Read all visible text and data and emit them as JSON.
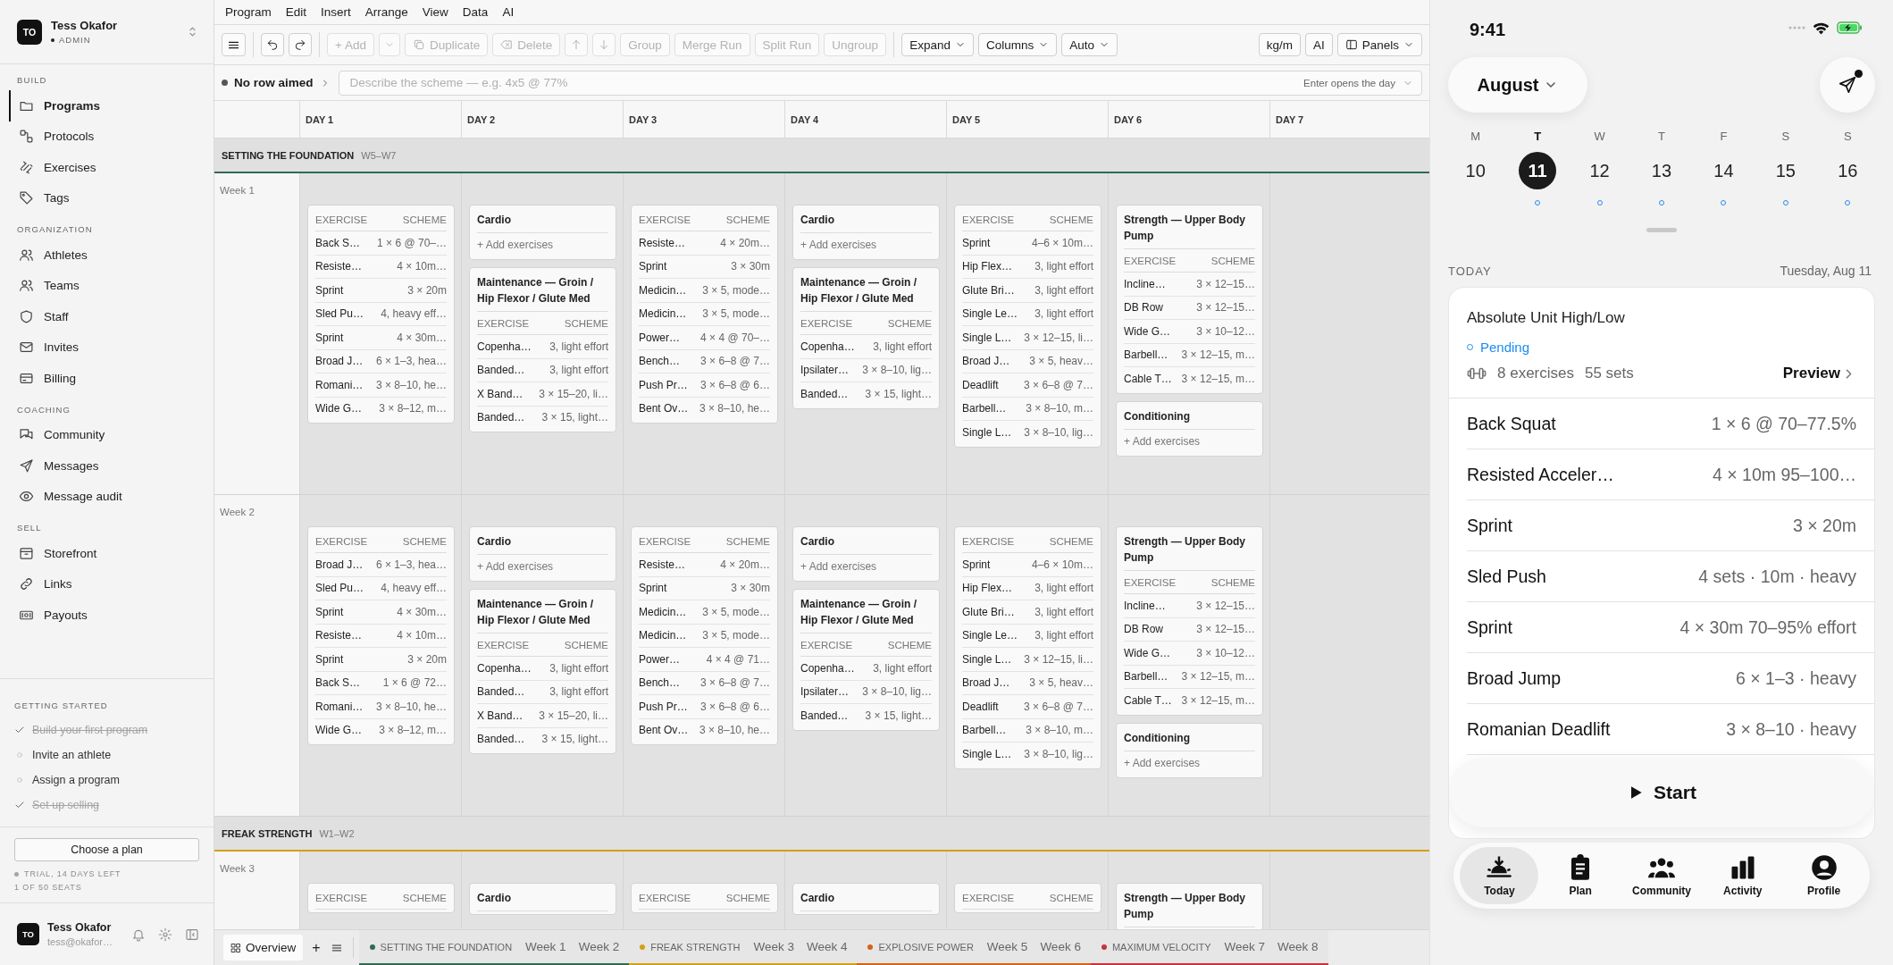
{
  "sidebar": {
    "user": {
      "initials": "TO",
      "name": "Tess Okafor",
      "role": "ADMIN"
    },
    "groups": [
      {
        "label": "BUILD",
        "items": [
          {
            "label": "Programs",
            "selected": true
          },
          {
            "label": "Protocols",
            "selected": false
          },
          {
            "label": "Exercises",
            "selected": false
          },
          {
            "label": "Tags",
            "selected": false
          }
        ]
      },
      {
        "label": "ORGANIZATION",
        "items": [
          {
            "label": "Athletes",
            "selected": false
          },
          {
            "label": "Teams",
            "selected": false
          },
          {
            "label": "Staff",
            "selected": false
          },
          {
            "label": "Invites",
            "selected": false
          },
          {
            "label": "Billing",
            "selected": false
          }
        ]
      },
      {
        "label": "COACHING",
        "items": [
          {
            "label": "Community",
            "selected": false
          },
          {
            "label": "Messages",
            "selected": false
          },
          {
            "label": "Message audit",
            "selected": false
          }
        ]
      },
      {
        "label": "SELL",
        "items": [
          {
            "label": "Storefront",
            "selected": false
          },
          {
            "label": "Links",
            "selected": false
          },
          {
            "label": "Payouts",
            "selected": false
          }
        ]
      }
    ],
    "getting_started": {
      "title": "GETTING STARTED",
      "items": [
        {
          "label": "Build your first program",
          "done": true
        },
        {
          "label": "Invite an athlete",
          "done": false
        },
        {
          "label": "Assign a program",
          "done": false
        },
        {
          "label": "Set up selling",
          "done": true
        }
      ]
    },
    "plan_button": "Choose a plan",
    "trial": "TRIAL, 14 DAYS LEFT",
    "seats": "1 OF 50 SEATS",
    "footer": {
      "initials": "TO",
      "name": "Tess Okafor",
      "email": "tess@okafor…"
    }
  },
  "menu": [
    "Program",
    "Edit",
    "Insert",
    "Arrange",
    "View",
    "Data",
    "AI"
  ],
  "toolbar": {
    "actions": [
      {
        "label": "+ Add",
        "disabled": true
      },
      {
        "label": "Duplicate",
        "disabled": true
      },
      {
        "label": "Delete",
        "disabled": true
      },
      {
        "disabled": true
      },
      {
        "disabled": true
      },
      {
        "label": "Group",
        "disabled": true
      },
      {
        "label": "Merge Run",
        "disabled": true
      },
      {
        "label": "Split Run",
        "disabled": true
      },
      {
        "label": "Ungroup",
        "disabled": true
      }
    ],
    "views": [
      "Expand",
      "Columns",
      "Auto"
    ],
    "right": [
      "kg/m",
      "AI",
      "Panels"
    ]
  },
  "aim": {
    "status": "No row aimed",
    "placeholder": "Describe the scheme — e.g. 4x5 @ 77%",
    "hint": "Enter opens the day"
  },
  "days": [
    "DAY 1",
    "DAY 2",
    "DAY 3",
    "DAY 4",
    "DAY 5",
    "DAY 6",
    "DAY 7"
  ],
  "sections": [
    {
      "name": "SETTING THE FOUNDATION",
      "range": "W5–W7",
      "color": "#2f6b52",
      "weeks": [
        {
          "label": "Week 1",
          "days": [
            [
              {
                "columns": [
                  "EXERCISE",
                  "SCHEME"
                ],
                "rows": [
                  [
                    "Back S…",
                    "1 × 6 @ 70–…"
                  ],
                  [
                    "Resiste…",
                    "4 × 10m…"
                  ],
                  [
                    "Sprint",
                    "3 × 20m"
                  ],
                  [
                    "Sled Pu…",
                    "4, heavy eff…"
                  ],
                  [
                    "Sprint",
                    "4 × 30m…"
                  ],
                  [
                    "Broad J…",
                    "6 × 1–3, hea…"
                  ],
                  [
                    "Romani…",
                    "3 × 8–10, he…"
                  ],
                  [
                    "Wide G…",
                    "3 × 8–12, m…"
                  ]
                ]
              }
            ],
            [
              {
                "title": "Cardio",
                "add": "+ Add exercises"
              },
              {
                "title": "Maintenance — Groin / Hip Flexor / Glute Med",
                "columns": [
                  "EXERCISE",
                  "SCHEME"
                ],
                "rows": [
                  [
                    "Copenha…",
                    "3, light effort"
                  ],
                  [
                    "Banded…",
                    "3, light effort"
                  ],
                  [
                    "X Band…",
                    "3 × 15–20, li…"
                  ],
                  [
                    "Banded…",
                    "3 × 15, light…"
                  ]
                ]
              }
            ],
            [
              {
                "columns": [
                  "EXERCISE",
                  "SCHEME"
                ],
                "rows": [
                  [
                    "Resiste…",
                    "4 × 20m…"
                  ],
                  [
                    "Sprint",
                    "3 × 30m"
                  ],
                  [
                    "Medicin…",
                    "3 × 5, mode…"
                  ],
                  [
                    "Medicin…",
                    "3 × 5, mode…"
                  ],
                  [
                    "Power…",
                    "4 × 4 @ 70–…"
                  ],
                  [
                    "Bench…",
                    "3 × 6–8 @ 7…"
                  ],
                  [
                    "Push Pr…",
                    "3 × 6–8 @ 6…"
                  ],
                  [
                    "Bent Ov…",
                    "3 × 8–10, he…"
                  ]
                ]
              }
            ],
            [
              {
                "title": "Cardio",
                "add": "+ Add exercises"
              },
              {
                "title": "Maintenance — Groin / Hip Flexor / Glute Med",
                "columns": [
                  "EXERCISE",
                  "SCHEME"
                ],
                "rows": [
                  [
                    "Copenha…",
                    "3, light effort"
                  ],
                  [
                    "Ipsilater…",
                    "3 × 8–10, lig…"
                  ],
                  [
                    "Banded…",
                    "3 × 15, light…"
                  ]
                ]
              }
            ],
            [
              {
                "columns": [
                  "EXERCISE",
                  "SCHEME"
                ],
                "rows": [
                  [
                    "Sprint",
                    "4–6 × 10m…"
                  ],
                  [
                    "Hip Flex…",
                    "3, light effort"
                  ],
                  [
                    "Glute Bri…",
                    "3, light effort"
                  ],
                  [
                    "Single Le…",
                    "3, light effort"
                  ],
                  [
                    "Single L…",
                    "3 × 12–15, li…"
                  ],
                  [
                    "Broad J…",
                    "3 × 5, heav…"
                  ],
                  [
                    "Deadlift",
                    "3 × 6–8 @ 7…"
                  ],
                  [
                    "Barbell…",
                    "3 × 8–10, m…"
                  ],
                  [
                    "Single L…",
                    "3 × 8–10, lig…"
                  ]
                ]
              }
            ],
            [
              {
                "title": "Strength — Upper Body Pump",
                "columns": [
                  "EXERCISE",
                  "SCHEME"
                ],
                "rows": [
                  [
                    "Incline…",
                    "3 × 12–15…"
                  ],
                  [
                    "DB Row",
                    "3 × 12–15…"
                  ],
                  [
                    "Wide G…",
                    "3 × 10–12…"
                  ],
                  [
                    "Barbell…",
                    "3 × 12–15, m…"
                  ],
                  [
                    "Cable T…",
                    "3 × 12–15, m…"
                  ]
                ]
              },
              {
                "title": "Conditioning",
                "add": "+ Add exercises"
              }
            ]
          ]
        },
        {
          "label": "Week 2",
          "days": [
            [
              {
                "columns": [
                  "EXERCISE",
                  "SCHEME"
                ],
                "rows": [
                  [
                    "Broad J…",
                    "6 × 1–3, hea…"
                  ],
                  [
                    "Sled Pu…",
                    "4, heavy eff…"
                  ],
                  [
                    "Sprint",
                    "4 × 30m…"
                  ],
                  [
                    "Resiste…",
                    "4 × 10m…"
                  ],
                  [
                    "Sprint",
                    "3 × 20m"
                  ],
                  [
                    "Back S…",
                    "1 × 6 @ 72…"
                  ],
                  [
                    "Romani…",
                    "3 × 8–10, he…"
                  ],
                  [
                    "Wide G…",
                    "3 × 8–12, m…"
                  ]
                ]
              }
            ],
            [
              {
                "title": "Cardio",
                "add": "+ Add exercises"
              },
              {
                "title": "Maintenance — Groin / Hip Flexor / Glute Med",
                "columns": [
                  "EXERCISE",
                  "SCHEME"
                ],
                "rows": [
                  [
                    "Copenha…",
                    "3, light effort"
                  ],
                  [
                    "Banded…",
                    "3, light effort"
                  ],
                  [
                    "X Band…",
                    "3 × 15–20, li…"
                  ],
                  [
                    "Banded…",
                    "3 × 15, light…"
                  ]
                ]
              }
            ],
            [
              {
                "columns": [
                  "EXERCISE",
                  "SCHEME"
                ],
                "rows": [
                  [
                    "Resiste…",
                    "4 × 20m…"
                  ],
                  [
                    "Sprint",
                    "3 × 30m"
                  ],
                  [
                    "Medicin…",
                    "3 × 5, mode…"
                  ],
                  [
                    "Medicin…",
                    "3 × 5, mode…"
                  ],
                  [
                    "Power…",
                    "4 × 4 @ 71…"
                  ],
                  [
                    "Bench…",
                    "3 × 6–8 @ 7…"
                  ],
                  [
                    "Push Pr…",
                    "3 × 6–8 @ 6…"
                  ],
                  [
                    "Bent Ov…",
                    "3 × 8–10, he…"
                  ]
                ]
              }
            ],
            [
              {
                "title": "Cardio",
                "add": "+ Add exercises"
              },
              {
                "title": "Maintenance — Groin / Hip Flexor / Glute Med",
                "columns": [
                  "EXERCISE",
                  "SCHEME"
                ],
                "rows": [
                  [
                    "Copenha…",
                    "3, light effort"
                  ],
                  [
                    "Ipsilater…",
                    "3 × 8–10, lig…"
                  ],
                  [
                    "Banded…",
                    "3 × 15, light…"
                  ]
                ]
              }
            ],
            [
              {
                "columns": [
                  "EXERCISE",
                  "SCHEME"
                ],
                "rows": [
                  [
                    "Sprint",
                    "4–6 × 10m…"
                  ],
                  [
                    "Hip Flex…",
                    "3, light effort"
                  ],
                  [
                    "Glute Bri…",
                    "3, light effort"
                  ],
                  [
                    "Single Le…",
                    "3, light effort"
                  ],
                  [
                    "Single L…",
                    "3 × 12–15, li…"
                  ],
                  [
                    "Broad J…",
                    "3 × 5, heav…"
                  ],
                  [
                    "Deadlift",
                    "3 × 6–8 @ 7…"
                  ],
                  [
                    "Barbell…",
                    "3 × 8–10, m…"
                  ],
                  [
                    "Single L…",
                    "3 × 8–10, lig…"
                  ]
                ]
              }
            ],
            [
              {
                "title": "Strength — Upper Body Pump",
                "columns": [
                  "EXERCISE",
                  "SCHEME"
                ],
                "rows": [
                  [
                    "Incline…",
                    "3 × 12–15…"
                  ],
                  [
                    "DB Row",
                    "3 × 12–15…"
                  ],
                  [
                    "Wide G…",
                    "3 × 10–12…"
                  ],
                  [
                    "Barbell…",
                    "3 × 12–15, m…"
                  ],
                  [
                    "Cable T…",
                    "3 × 12–15, m…"
                  ]
                ]
              },
              {
                "title": "Conditioning",
                "add": "+ Add exercises"
              }
            ]
          ]
        }
      ]
    },
    {
      "name": "FREAK STRENGTH",
      "range": "W1–W2",
      "color": "#d4a017",
      "weeks": [
        {
          "label": "Week 3",
          "days": [
            [
              {
                "columns": [
                  "EXERCISE",
                  "SCHEME"
                ]
              }
            ],
            [
              {
                "title": "Cardio"
              }
            ],
            [
              {
                "columns": [
                  "EXERCISE",
                  "SCHEME"
                ]
              }
            ],
            [
              {
                "title": "Cardio"
              }
            ],
            [
              {
                "columns": [
                  "EXERCISE",
                  "SCHEME"
                ]
              }
            ],
            [
              {
                "title": "Strength — Upper Body Pump"
              }
            ]
          ]
        }
      ]
    }
  ],
  "tabbar": {
    "overview": {
      "label": "Overview",
      "selected": true
    },
    "add": "+",
    "groups": [
      {
        "name": "SETTING THE FOUNDATION",
        "color": "#2f6b52",
        "weeks": [
          "Week 1",
          "Week 2"
        ]
      },
      {
        "name": "FREAK STRENGTH",
        "color": "#d4a017",
        "weeks": [
          "Week 3",
          "Week 4"
        ]
      },
      {
        "name": "EXPLOSIVE POWER",
        "color": "#d4621a",
        "weeks": [
          "Week 5",
          "Week 6"
        ]
      },
      {
        "name": "MAXIMUM VELOCITY",
        "color": "#c6343a",
        "weeks": [
          "Week 7",
          "Week 8"
        ]
      }
    ]
  },
  "phone": {
    "time": "9:41",
    "month": "August",
    "week": [
      {
        "letter": "M",
        "number": "10",
        "selected": false,
        "planned": false
      },
      {
        "letter": "T",
        "number": "11",
        "selected": true,
        "planned": true
      },
      {
        "letter": "W",
        "number": "12",
        "selected": false,
        "planned": true
      },
      {
        "letter": "T",
        "number": "13",
        "selected": false,
        "planned": true
      },
      {
        "letter": "F",
        "number": "14",
        "selected": false,
        "planned": true
      },
      {
        "letter": "S",
        "number": "15",
        "selected": false,
        "planned": true
      },
      {
        "letter": "S",
        "number": "16",
        "selected": false,
        "planned": true
      }
    ],
    "today_label": "TODAY",
    "date": "Tuesday, Aug 11",
    "workout": {
      "title": "Absolute Unit High/Low",
      "status": "Pending",
      "exercises": "8 exercises",
      "sets": "55 sets",
      "preview": "Preview",
      "rows": [
        [
          "Back Squat",
          "1 × 6 @ 70–77.5%"
        ],
        [
          "Resisted Acceler…",
          "4 × 10m 95–100…"
        ],
        [
          "Sprint",
          "3 × 20m"
        ],
        [
          "Sled Push",
          "4 sets · 10m · heavy"
        ],
        [
          "Sprint",
          "4 × 30m 70–95% effort"
        ],
        [
          "Broad Jump",
          "6 × 1–3 · heavy"
        ],
        [
          "Romanian Deadlift",
          "3 × 8–10 · heavy"
        ]
      ]
    },
    "start": "Start",
    "tabs": [
      {
        "label": "Today",
        "selected": true
      },
      {
        "label": "Plan",
        "selected": false
      },
      {
        "label": "Community",
        "selected": false
      },
      {
        "label": "Activity",
        "selected": false
      },
      {
        "label": "Profile",
        "selected": false
      }
    ]
  }
}
